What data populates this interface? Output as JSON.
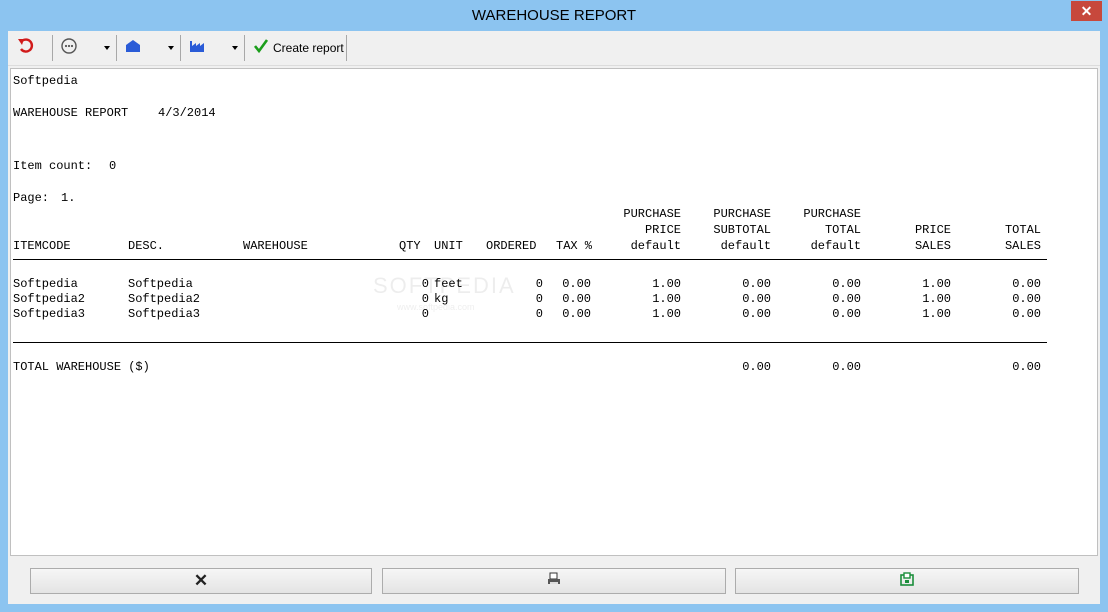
{
  "window": {
    "title": "WAREHOUSE REPORT",
    "close_glyph": "✕"
  },
  "toolbar": {
    "undo_icon": "undo-arrow-icon",
    "options_icon": "ellipsis-circle-icon",
    "warehouse_icon": "warehouse-house-icon",
    "factory_icon": "factory-icon",
    "create_report_label": "Create report",
    "create_report_color": "#1b9e1b"
  },
  "report": {
    "company": "Softpedia",
    "title": "WAREHOUSE REPORT",
    "date": "4/3/2014",
    "item_count_label": "Item count:",
    "item_count": "0",
    "page_label": "Page:",
    "page": "1.",
    "headers": {
      "itemcode": "ITEMCODE",
      "desc": "DESC.",
      "warehouse": "WAREHOUSE",
      "qty": "QTY",
      "unit": "UNIT",
      "ordered": "ORDERED",
      "tax": "TAX %",
      "purchase_price": [
        "PURCHASE",
        "PRICE",
        "default"
      ],
      "purchase_subtotal": [
        "PURCHASE",
        "SUBTOTAL",
        "default"
      ],
      "purchase_total": [
        "PURCHASE",
        "TOTAL",
        "default"
      ],
      "price_sales": [
        "PRICE",
        "SALES"
      ],
      "total_sales": [
        "TOTAL",
        "SALES"
      ]
    },
    "rows": [
      {
        "itemcode": "Softpedia",
        "desc": "Softpedia",
        "warehouse": "",
        "qty": "0",
        "unit": "feet",
        "ordered": "0",
        "tax": "0.00",
        "purchase_price": "1.00",
        "purchase_subtotal": "0.00",
        "purchase_total": "0.00",
        "price_sales": "1.00",
        "total_sales": "0.00"
      },
      {
        "itemcode": "Softpedia2",
        "desc": "Softpedia2",
        "warehouse": "",
        "qty": "0",
        "unit": "kg",
        "ordered": "0",
        "tax": "0.00",
        "purchase_price": "1.00",
        "purchase_subtotal": "0.00",
        "purchase_total": "0.00",
        "price_sales": "1.00",
        "total_sales": "0.00"
      },
      {
        "itemcode": "Softpedia3",
        "desc": "Softpedia3",
        "warehouse": "",
        "qty": "0",
        "unit": "",
        "ordered": "0",
        "tax": "0.00",
        "purchase_price": "1.00",
        "purchase_subtotal": "0.00",
        "purchase_total": "0.00",
        "price_sales": "1.00",
        "total_sales": "0.00"
      }
    ],
    "totals": {
      "label": "TOTAL WAREHOUSE ($)",
      "purchase_subtotal": "0.00",
      "purchase_total": "0.00",
      "total_sales": "0.00"
    },
    "watermark": "SOFTPEDIA",
    "watermark_url": "www.softpedia.com"
  },
  "bottom": {
    "cancel_glyph": "✕",
    "print_icon": "printer-icon",
    "export_icon": "export-green-icon"
  }
}
